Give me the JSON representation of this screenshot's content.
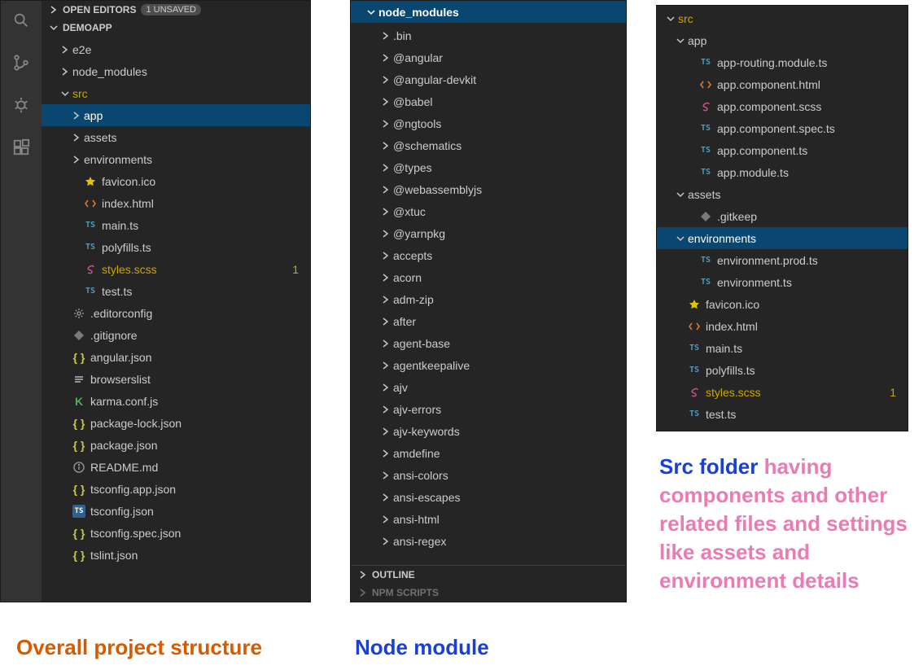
{
  "panel1": {
    "openEditors": {
      "label": "OPEN EDITORS",
      "unsaved_badge": "1 UNSAVED"
    },
    "project": "DEMOAPP",
    "tree": [
      {
        "id": "e2e",
        "label": "e2e",
        "type": "folder",
        "depth": 1,
        "expanded": false
      },
      {
        "id": "node_modules",
        "label": "node_modules",
        "type": "folder",
        "depth": 1,
        "expanded": false
      },
      {
        "id": "src",
        "label": "src",
        "type": "folder",
        "depth": 1,
        "expanded": true,
        "modified": true,
        "statusDot": true
      },
      {
        "id": "app",
        "label": "app",
        "type": "folder",
        "depth": 2,
        "expanded": false,
        "selected": true
      },
      {
        "id": "assets",
        "label": "assets",
        "type": "folder",
        "depth": 2,
        "expanded": false
      },
      {
        "id": "envs",
        "label": "environments",
        "type": "folder",
        "depth": 2,
        "expanded": false
      },
      {
        "id": "favicon",
        "label": "favicon.ico",
        "type": "file",
        "depth": 2,
        "icon": "star"
      },
      {
        "id": "indexhtml",
        "label": "index.html",
        "type": "file",
        "depth": 2,
        "icon": "html"
      },
      {
        "id": "maints",
        "label": "main.ts",
        "type": "file",
        "depth": 2,
        "icon": "ts"
      },
      {
        "id": "polyfills",
        "label": "polyfills.ts",
        "type": "file",
        "depth": 2,
        "icon": "ts"
      },
      {
        "id": "styles",
        "label": "styles.scss",
        "type": "file",
        "depth": 2,
        "icon": "scss",
        "modified": true,
        "trail": "1"
      },
      {
        "id": "testts",
        "label": "test.ts",
        "type": "file",
        "depth": 2,
        "icon": "ts"
      },
      {
        "id": "editorconfig",
        "label": ".editorconfig",
        "type": "file",
        "depth": 1,
        "icon": "gear"
      },
      {
        "id": "gitignore",
        "label": ".gitignore",
        "type": "file",
        "depth": 1,
        "icon": "diamond"
      },
      {
        "id": "angularjson",
        "label": "angular.json",
        "type": "file",
        "depth": 1,
        "icon": "json"
      },
      {
        "id": "browserslist",
        "label": "browserslist",
        "type": "file",
        "depth": 1,
        "icon": "lines"
      },
      {
        "id": "karma",
        "label": "karma.conf.js",
        "type": "file",
        "depth": 1,
        "icon": "karma"
      },
      {
        "id": "pkglock",
        "label": "package-lock.json",
        "type": "file",
        "depth": 1,
        "icon": "json"
      },
      {
        "id": "pkg",
        "label": "package.json",
        "type": "file",
        "depth": 1,
        "icon": "json"
      },
      {
        "id": "readme",
        "label": "README.md",
        "type": "file",
        "depth": 1,
        "icon": "info"
      },
      {
        "id": "tsconfapp",
        "label": "tsconfig.app.json",
        "type": "file",
        "depth": 1,
        "icon": "json"
      },
      {
        "id": "tsconf",
        "label": "tsconfig.json",
        "type": "file",
        "depth": 1,
        "icon": "tsjson"
      },
      {
        "id": "tsconfspec",
        "label": "tsconfig.spec.json",
        "type": "file",
        "depth": 1,
        "icon": "json"
      },
      {
        "id": "tslint",
        "label": "tslint.json",
        "type": "file",
        "depth": 1,
        "icon": "json"
      }
    ]
  },
  "panel2": {
    "header": "node_modules",
    "items": [
      ".bin",
      "@angular",
      "@angular-devkit",
      "@babel",
      "@ngtools",
      "@schematics",
      "@types",
      "@webassemblyjs",
      "@xtuc",
      "@yarnpkg",
      "accepts",
      "acorn",
      "adm-zip",
      "after",
      "agent-base",
      "agentkeepalive",
      "ajv",
      "ajv-errors",
      "ajv-keywords",
      "amdefine",
      "ansi-colors",
      "ansi-escapes",
      "ansi-html",
      "ansi-regex"
    ],
    "outline": "OUTLINE",
    "npmscripts": "NPM SCRIPTS"
  },
  "panel3": {
    "tree": [
      {
        "id": "src",
        "label": "src",
        "type": "folder",
        "depth": 0,
        "expanded": true,
        "modified": true,
        "statusDot": true
      },
      {
        "id": "app",
        "label": "app",
        "type": "folder",
        "depth": 1,
        "expanded": true
      },
      {
        "id": "approuting",
        "label": "app-routing.module.ts",
        "type": "file",
        "depth": 2,
        "icon": "ts"
      },
      {
        "id": "apphtml",
        "label": "app.component.html",
        "type": "file",
        "depth": 2,
        "icon": "html"
      },
      {
        "id": "appscss",
        "label": "app.component.scss",
        "type": "file",
        "depth": 2,
        "icon": "scss"
      },
      {
        "id": "appspec",
        "label": "app.component.spec.ts",
        "type": "file",
        "depth": 2,
        "icon": "ts"
      },
      {
        "id": "appcomp",
        "label": "app.component.ts",
        "type": "file",
        "depth": 2,
        "icon": "ts"
      },
      {
        "id": "appmod",
        "label": "app.module.ts",
        "type": "file",
        "depth": 2,
        "icon": "ts"
      },
      {
        "id": "assets",
        "label": "assets",
        "type": "folder",
        "depth": 1,
        "expanded": true
      },
      {
        "id": "gitkeep",
        "label": ".gitkeep",
        "type": "file",
        "depth": 2,
        "icon": "diamond"
      },
      {
        "id": "envs",
        "label": "environments",
        "type": "folder",
        "depth": 1,
        "expanded": true,
        "selected": true
      },
      {
        "id": "envprod",
        "label": "environment.prod.ts",
        "type": "file",
        "depth": 2,
        "icon": "ts"
      },
      {
        "id": "envts",
        "label": "environment.ts",
        "type": "file",
        "depth": 2,
        "icon": "ts"
      },
      {
        "id": "favicon",
        "label": "favicon.ico",
        "type": "file",
        "depth": 1,
        "icon": "star"
      },
      {
        "id": "indexhtml",
        "label": "index.html",
        "type": "file",
        "depth": 1,
        "icon": "html"
      },
      {
        "id": "maints",
        "label": "main.ts",
        "type": "file",
        "depth": 1,
        "icon": "ts"
      },
      {
        "id": "polyfills",
        "label": "polyfills.ts",
        "type": "file",
        "depth": 1,
        "icon": "ts"
      },
      {
        "id": "styles",
        "label": "styles.scss",
        "type": "file",
        "depth": 1,
        "icon": "scss",
        "modified": true,
        "trail": "1"
      },
      {
        "id": "testts",
        "label": "test.ts",
        "type": "file",
        "depth": 1,
        "icon": "ts"
      }
    ]
  },
  "captions": {
    "c1": "Overall project structure",
    "c2": "Node module",
    "c3_lead": "Src folder ",
    "c3_rest": "having components and other related files and settings like assets and environment details"
  }
}
